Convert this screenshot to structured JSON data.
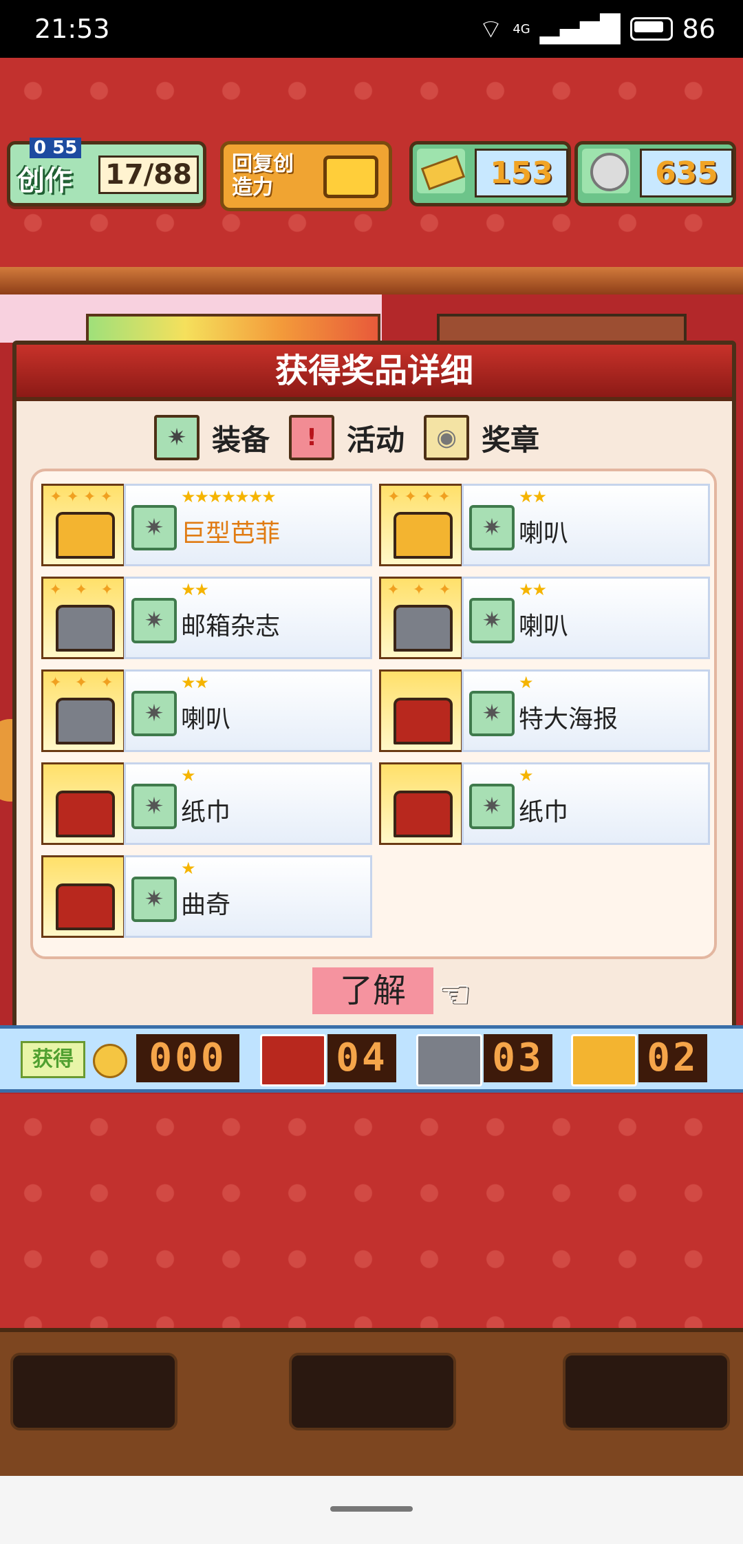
{
  "status_bar": {
    "time": "21:53",
    "network": "4G",
    "battery": "86"
  },
  "hud": {
    "create_label": "创作",
    "create_small": "0 55",
    "create_count": "17/88",
    "restore_label": "回复创造力",
    "gold_value": "153",
    "coin_value": "635"
  },
  "dialog": {
    "title": "获得奖品详细",
    "legend": [
      {
        "label": "装备",
        "icon": "gear-icon"
      },
      {
        "label": "活动",
        "icon": "exclamation-icon"
      },
      {
        "label": "奖章",
        "icon": "medal-icon"
      }
    ],
    "prizes": [
      {
        "name": "巨型芭菲",
        "stars": "★★★★★★★",
        "chest": "gold",
        "highlight": true
      },
      {
        "name": "喇叭",
        "stars": "★★",
        "chest": "gold",
        "highlight": false
      },
      {
        "name": "邮箱杂志",
        "stars": "★★",
        "chest": "silver",
        "highlight": false
      },
      {
        "name": "喇叭",
        "stars": "★★",
        "chest": "silver",
        "highlight": false
      },
      {
        "name": "喇叭",
        "stars": "★★",
        "chest": "silver",
        "highlight": false
      },
      {
        "name": "特大海报",
        "stars": "★",
        "chest": "red",
        "highlight": false
      },
      {
        "name": "纸巾",
        "stars": "★",
        "chest": "red",
        "highlight": false
      },
      {
        "name": "纸巾",
        "stars": "★",
        "chest": "red",
        "highlight": false
      },
      {
        "name": "曲奇",
        "stars": "★",
        "chest": "red",
        "highlight": false
      }
    ],
    "ok_label": "了解"
  },
  "counter_bar": {
    "label": "获得",
    "coin_count": "000",
    "red_chest_count": "04",
    "silver_chest_count": "03",
    "gold_chest_count": "02"
  }
}
